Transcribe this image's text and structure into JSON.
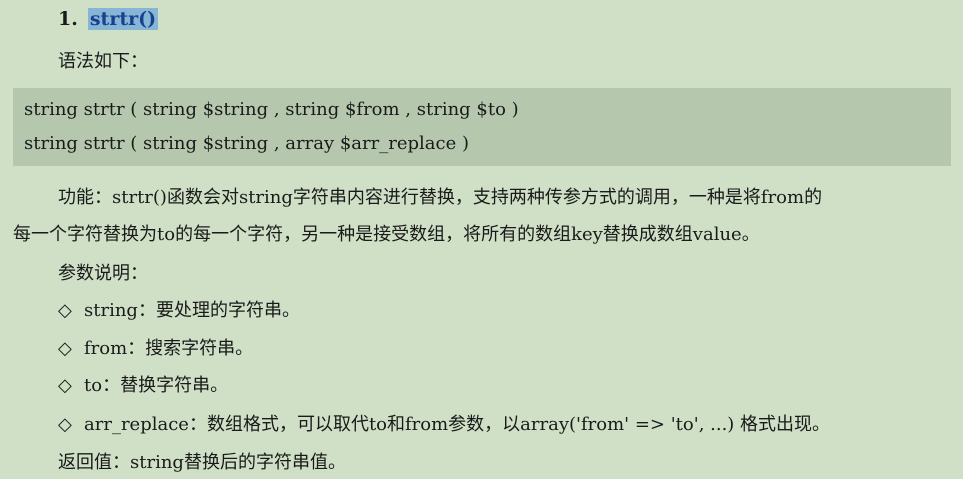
{
  "heading": {
    "number": "1.",
    "function_name": "strtr()"
  },
  "syntax_label": "语法如下：",
  "code": [
    "string strtr ( string $string , string $from , string $to )",
    "string strtr ( string $string , array $arr_replace )"
  ],
  "description": {
    "line1": "功能：strtr()函数会对string字符串内容进行替换，支持两种传参方式的调用，一种是将from的",
    "line2": "每一个字符替换为to的每一个字符，另一种是接受数组，将所有的数组key替换成数组value。"
  },
  "params_label": "参数说明：",
  "params": [
    {
      "bullet": "◇",
      "text": "string：要处理的字符串。"
    },
    {
      "bullet": "◇",
      "text": "from：搜索字符串。"
    },
    {
      "bullet": "◇",
      "text": "to：替换字符串。"
    },
    {
      "bullet": "◇",
      "text": "arr_replace：数组格式，可以取代to和from参数，以array('from' => 'to', ...) 格式出现。"
    }
  ],
  "return_value": "返回值：string替换后的字符串值。",
  "colors": {
    "background": "#cfe0c6",
    "code_box": "#b5c8ad",
    "highlight": "#86b6d6",
    "highlight_text": "#1b3f8f"
  }
}
